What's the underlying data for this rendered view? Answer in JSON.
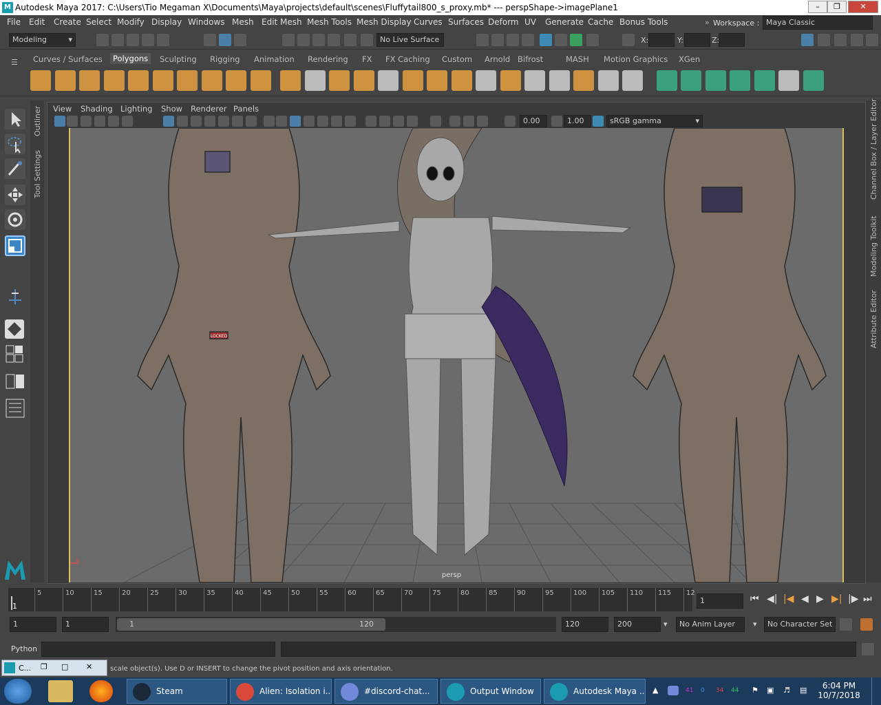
{
  "window": {
    "title": "Autodesk Maya 2017: C:\\Users\\Tio Megaman X\\Documents\\Maya\\projects\\default\\scenes\\Fluffytail800_s_proxy.mb*  ---  perspShape->imagePlane1",
    "logo": "M"
  },
  "menus": [
    "File",
    "Edit",
    "Create",
    "Select",
    "Modify",
    "Display",
    "Windows",
    "Mesh",
    "Edit Mesh",
    "Mesh Tools",
    "Mesh Display",
    "Curves",
    "Surfaces",
    "Deform",
    "UV",
    "Generate",
    "Cache",
    "Bonus Tools"
  ],
  "workspace": {
    "label": "Workspace :",
    "value": "Maya Classic"
  },
  "status": {
    "mode": "Modeling",
    "live_surface": "No Live Surface",
    "x_label": "X:",
    "y_label": "Y:",
    "z_label": "Z:"
  },
  "shelf_tabs": [
    "Curves / Surfaces",
    "Polygons",
    "Sculpting",
    "Rigging",
    "Animation",
    "Rendering",
    "FX",
    "FX Caching",
    "Custom",
    "Arnold",
    "Bifrost",
    "MASH",
    "Motion Graphics",
    "XGen"
  ],
  "shelf_active": "Polygons",
  "shelf_icons": [
    {
      "name": "sphere-icon",
      "color": "#e8a040"
    },
    {
      "name": "cube-icon",
      "color": "#e8a040"
    },
    {
      "name": "cylinder-icon",
      "color": "#e8a040"
    },
    {
      "name": "cone-icon",
      "color": "#e8a040"
    },
    {
      "name": "plane-icon",
      "color": "#e8a040"
    },
    {
      "name": "torus-icon",
      "color": "#e8a040"
    },
    {
      "name": "pyramid-icon",
      "color": "#e8a040"
    },
    {
      "name": "pipe-icon",
      "color": "#e8a040"
    },
    {
      "name": "type-icon",
      "color": "#e8a040"
    },
    {
      "name": "svg-icon",
      "color": "#e8a040"
    },
    {
      "name": "combine-icon",
      "color": "#e8a040"
    },
    {
      "name": "separate-icon",
      "color": "#d0d0d0"
    },
    {
      "name": "mirror-icon",
      "color": "#e8a040"
    },
    {
      "name": "smooth-icon",
      "color": "#e8a040"
    },
    {
      "name": "reduce-icon",
      "color": "#d0d0d0"
    },
    {
      "name": "remesh-icon",
      "color": "#e8a040"
    },
    {
      "name": "multicut-icon",
      "color": "#e8a040"
    },
    {
      "name": "extrude-icon",
      "color": "#e8a040"
    },
    {
      "name": "bridge-icon",
      "color": "#d0d0d0"
    },
    {
      "name": "bevel-icon",
      "color": "#e8a040"
    },
    {
      "name": "insert-loop-icon",
      "color": "#d0d0d0"
    },
    {
      "name": "offset-loop-icon",
      "color": "#d0d0d0"
    },
    {
      "name": "append-icon",
      "color": "#e8a040"
    },
    {
      "name": "merge-icon",
      "color": "#d0d0d0"
    },
    {
      "name": "fill-hole-icon",
      "color": "#d0d0d0"
    },
    {
      "name": "planar-map-icon",
      "color": "#3ab08a"
    },
    {
      "name": "cylindrical-map-icon",
      "color": "#3ab08a"
    },
    {
      "name": "spherical-map-icon",
      "color": "#3ab08a"
    },
    {
      "name": "auto-map-icon",
      "color": "#3ab08a"
    },
    {
      "name": "uv-editor-icon",
      "color": "#3ab08a"
    },
    {
      "name": "checker-icon",
      "color": "#d0d0d0"
    },
    {
      "name": "unfold-icon",
      "color": "#3ab08a"
    }
  ],
  "panel_menus": [
    "View",
    "Shading",
    "Lighting",
    "Show",
    "Renderer",
    "Panels"
  ],
  "panel_fields": {
    "exposure": "0.00",
    "gamma": "1.00",
    "color_space": "sRGB gamma"
  },
  "side_tabs_left": [
    "Outliner",
    "Tool Settings"
  ],
  "side_tabs_right": [
    "Channel Box / Layer Editor",
    "Modeling Toolkit",
    "Attribute Editor"
  ],
  "viewport": {
    "camera_label": "persp",
    "axis_y": "y",
    "axis_x": "x",
    "badge_front": "LOCKED"
  },
  "timeline": {
    "ticks": [
      "5",
      "10",
      "15",
      "20",
      "25",
      "30",
      "35",
      "40",
      "45",
      "50",
      "55",
      "60",
      "65",
      "70",
      "75",
      "80",
      "85",
      "90",
      "95",
      "100",
      "105",
      "110",
      "115",
      "12"
    ],
    "start_marker": "1",
    "current_frame": "1"
  },
  "range": {
    "start": "1",
    "playback_start": "1",
    "slider_start": "1",
    "slider_end": "120",
    "playback_end": "120",
    "end": "200",
    "anim_layer": "No Anim Layer",
    "char_set": "No Character Set"
  },
  "python": {
    "label": "Python"
  },
  "help_line": "scale object(s). Use D or INSERT to change the pivot position and axis orientation.",
  "minimized_window": {
    "label": "C..."
  },
  "taskbar": {
    "tasks": [
      {
        "label": "Steam",
        "color": "#1b2838"
      },
      {
        "label": "Alien: Isolation i...",
        "color": "#d94a3a"
      },
      {
        "label": "#​discord-chat...",
        "color": "#7289da"
      },
      {
        "label": "Output Window",
        "color": "#1a9bb0"
      },
      {
        "label": "Autodesk Maya ...",
        "color": "#1a9bb0"
      }
    ],
    "tray_numbers": [
      "41",
      "0",
      "34",
      "44"
    ],
    "time": "6:04 PM",
    "date": "10/7/2018"
  }
}
